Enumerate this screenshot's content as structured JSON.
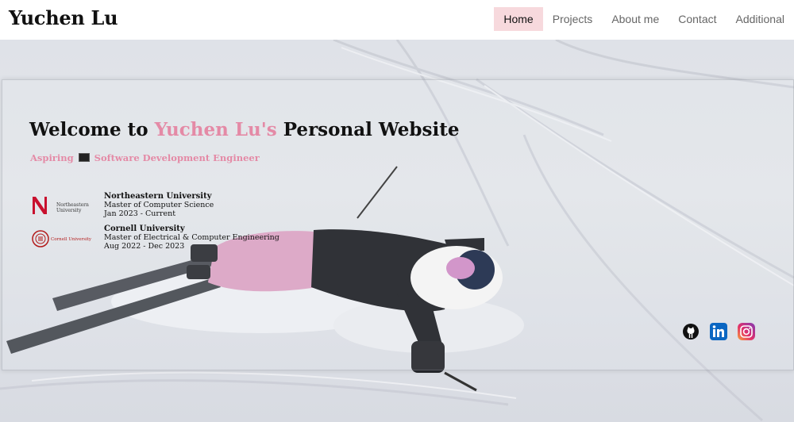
{
  "nav": {
    "brand": "Yuchen Lu",
    "items": [
      {
        "label": "Home",
        "active": true
      },
      {
        "label": "Projects",
        "active": false
      },
      {
        "label": "About me",
        "active": false
      },
      {
        "label": "Contact",
        "active": false
      },
      {
        "label": "Additional",
        "active": false
      }
    ]
  },
  "hero": {
    "welcome_prefix": "Welcome to ",
    "welcome_name": "Yuchen Lu's",
    "welcome_suffix": " Personal Website",
    "subtitle_prefix": "Aspiring",
    "subtitle_icon": "laptop-icon",
    "subtitle_suffix": "Software Development Engineer",
    "education": [
      {
        "logo": "northeastern-logo",
        "logo_text": "Northeastern University",
        "school": "Northeastern University",
        "degree": "Master of Computer Science",
        "dates": "Jan 2023 - Current"
      },
      {
        "logo": "cornell-seal-logo",
        "logo_text": "Cornell University",
        "school": "Cornell University",
        "degree": "Master of Electrical & Computer Engineering",
        "dates": "Aug 2022 - Dec 2023"
      }
    ],
    "social": [
      {
        "icon": "github-icon"
      },
      {
        "icon": "linkedin-icon"
      },
      {
        "icon": "instagram-icon"
      }
    ]
  },
  "colors": {
    "accent_pink": "#e48aa6",
    "active_nav_bg": "#f7d9dd",
    "linkedin_blue": "#0a66c2"
  }
}
